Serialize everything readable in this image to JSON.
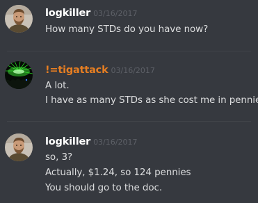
{
  "messages": [
    {
      "username": "logkiller",
      "timestamp": "03/16/2017",
      "lines": [
        "How many STDs do you have now?"
      ],
      "avatar": "bearded-man-avatar"
    },
    {
      "username": "!=tigattack",
      "timestamp": "03/16/2017",
      "lines": [
        "A lot.",
        "I have as many STDs as she cost me in pennies."
      ],
      "avatar": "green-laser-crowd-avatar",
      "name_color": "#e67e22"
    },
    {
      "username": "logkiller",
      "timestamp": "03/16/2017",
      "lines": [
        "so, 3?",
        "Actually, $1.24, so 124 pennies",
        "You should go to the doc."
      ],
      "avatar": "bearded-man-avatar"
    }
  ]
}
